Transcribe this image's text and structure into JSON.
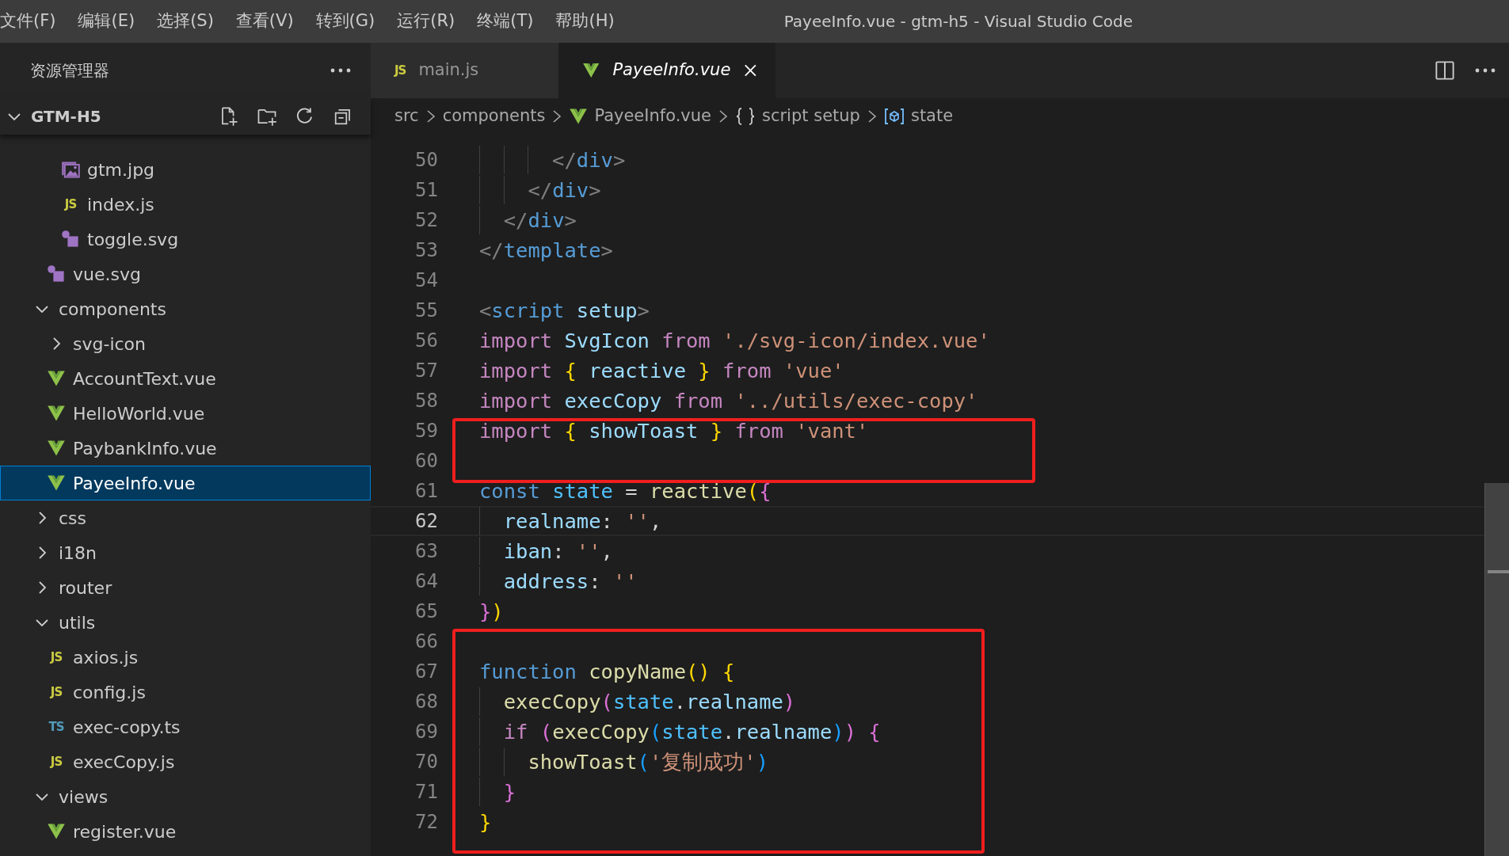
{
  "menu": [
    "文件(F)",
    "编辑(E)",
    "选择(S)",
    "查看(V)",
    "转到(G)",
    "运行(R)",
    "终端(T)",
    "帮助(H)"
  ],
  "window": {
    "title": "PayeeInfo.vue - gtm-h5 - Visual Studio Code"
  },
  "sidebar": {
    "title": "资源管理器",
    "tree": [
      {
        "label": "GTM-H5",
        "kind": "root",
        "expanded": true,
        "children": [
          {
            "kind": "offscreen",
            "children": [
              {
                "kind": "offscreen",
                "children": [
                  {
                    "kind": "offscreen",
                    "children": [
                      {
                        "label": "gtm.jpg",
                        "kind": "image",
                        "selected": false
                      },
                      {
                        "label": "index.js",
                        "kind": "js",
                        "badge": "JS",
                        "selected": false
                      },
                      {
                        "label": "toggle.svg",
                        "kind": "svg",
                        "selected": false
                      }
                    ]
                  },
                  {
                    "label": "vue.svg",
                    "kind": "svg",
                    "selected": false
                  }
                ]
              },
              {
                "label": "components",
                "kind": "folder",
                "expanded": true,
                "selected": false,
                "children": [
                  {
                    "label": "svg-icon",
                    "kind": "folder",
                    "expanded": false,
                    "selected": false
                  },
                  {
                    "label": "AccountText.vue",
                    "kind": "vue",
                    "selected": false
                  },
                  {
                    "label": "HelloWorld.vue",
                    "kind": "vue",
                    "selected": false
                  },
                  {
                    "label": "PaybankInfo.vue",
                    "kind": "vue",
                    "selected": false
                  },
                  {
                    "label": "PayeeInfo.vue",
                    "kind": "vue",
                    "selected": true
                  }
                ]
              },
              {
                "label": "css",
                "kind": "folder",
                "expanded": false,
                "selected": false
              },
              {
                "label": "i18n",
                "kind": "folder",
                "expanded": false,
                "selected": false
              },
              {
                "label": "router",
                "kind": "folder",
                "expanded": false,
                "selected": false
              },
              {
                "label": "utils",
                "kind": "folder",
                "expanded": true,
                "selected": false,
                "children": [
                  {
                    "label": "axios.js",
                    "kind": "js",
                    "badge": "JS",
                    "selected": false
                  },
                  {
                    "label": "config.js",
                    "kind": "js",
                    "badge": "JS",
                    "selected": false
                  },
                  {
                    "label": "exec-copy.ts",
                    "kind": "ts",
                    "badge": "TS",
                    "selected": false
                  },
                  {
                    "label": "execCopy.js",
                    "kind": "js",
                    "badge": "JS",
                    "selected": false
                  }
                ]
              },
              {
                "label": "views",
                "kind": "folder",
                "expanded": true,
                "selected": false,
                "children": [
                  {
                    "label": "register.vue",
                    "kind": "vue",
                    "selected": false
                  }
                ]
              }
            ]
          }
        ]
      }
    ]
  },
  "tabs": [
    {
      "label": "main.js",
      "kind": "js",
      "badge": "JS",
      "selected": false
    },
    {
      "label": "PayeeInfo.vue",
      "kind": "vue",
      "selected": true
    }
  ],
  "breadcrumb": [
    {
      "label": "src",
      "kind": "folder"
    },
    {
      "label": "components",
      "kind": "folder"
    },
    {
      "label": "PayeeInfo.vue",
      "kind": "vue"
    },
    {
      "label": "script setup",
      "kind": "module"
    },
    {
      "label": "state",
      "kind": "variable"
    }
  ],
  "code": {
    "sections": [
      {
        "boxed": false,
        "lines": [
          {
            "number": "50",
            "current": false,
            "tokens": [
              {
                "text": "      </",
                "kind": "punct"
              },
              {
                "text": "div",
                "kind": "tag"
              },
              {
                "text": ">",
                "kind": "punct"
              }
            ]
          },
          {
            "number": "51",
            "current": false,
            "tokens": [
              {
                "text": "    </",
                "kind": "punct"
              },
              {
                "text": "div",
                "kind": "tag"
              },
              {
                "text": ">",
                "kind": "punct"
              }
            ]
          },
          {
            "number": "52",
            "current": false,
            "tokens": [
              {
                "text": "  </",
                "kind": "punct"
              },
              {
                "text": "div",
                "kind": "tag"
              },
              {
                "text": ">",
                "kind": "punct"
              }
            ]
          },
          {
            "number": "53",
            "current": false,
            "tokens": [
              {
                "text": "</",
                "kind": "punct"
              },
              {
                "text": "template",
                "kind": "tag"
              },
              {
                "text": ">",
                "kind": "punct"
              }
            ]
          },
          {
            "number": "54",
            "current": false
          },
          {
            "number": "55",
            "current": false,
            "tokens": [
              {
                "text": "<",
                "kind": "punct"
              },
              {
                "text": "script ",
                "kind": "tag"
              },
              {
                "text": "setup",
                "kind": "var"
              },
              {
                "text": ">",
                "kind": "punct"
              }
            ]
          },
          {
            "number": "56",
            "current": false,
            "tokens": [
              {
                "text": "import ",
                "kind": "kw"
              },
              {
                "text": "SvgIcon ",
                "kind": "var"
              },
              {
                "text": "from ",
                "kind": "kw"
              },
              {
                "text": "'./svg-icon/index.vue'",
                "kind": "str"
              }
            ]
          },
          {
            "number": "57",
            "current": false,
            "tokens": [
              {
                "text": "import ",
                "kind": "kw"
              },
              {
                "text": "{ ",
                "kind": "b1"
              },
              {
                "text": "reactive ",
                "kind": "var"
              },
              {
                "text": "} ",
                "kind": "b1"
              },
              {
                "text": "from ",
                "kind": "kw"
              },
              {
                "text": "'vue'",
                "kind": "str"
              }
            ]
          },
          {
            "number": "58",
            "current": false,
            "tokens": [
              {
                "text": "import ",
                "kind": "kw"
              },
              {
                "text": "execCopy ",
                "kind": "var"
              },
              {
                "text": "from ",
                "kind": "kw"
              },
              {
                "text": "'../utils/exec-copy'",
                "kind": "str"
              }
            ]
          }
        ]
      },
      {
        "boxed": true,
        "lines": [
          {
            "number": "59",
            "current": false,
            "tokens": [
              {
                "text": "import ",
                "kind": "kw"
              },
              {
                "text": "{ ",
                "kind": "b1"
              },
              {
                "text": "showToast ",
                "kind": "var"
              },
              {
                "text": "} ",
                "kind": "b1"
              },
              {
                "text": "from ",
                "kind": "kw"
              },
              {
                "text": "'vant'",
                "kind": "str"
              }
            ]
          },
          {
            "number": "60",
            "current": false
          }
        ]
      },
      {
        "boxed": false,
        "lines": [
          {
            "number": "61",
            "current": false,
            "tokens": [
              {
                "text": "const ",
                "kind": "storage"
              },
              {
                "text": "state ",
                "kind": "const"
              },
              {
                "text": "= ",
                "kind": "plain"
              },
              {
                "text": "reactive",
                "kind": "fn"
              },
              {
                "text": "(",
                "kind": "b1"
              },
              {
                "text": "{",
                "kind": "b2"
              }
            ]
          },
          {
            "number": "62",
            "current": true,
            "tokens": [
              {
                "text": "  realname",
                "kind": "var"
              },
              {
                "text": ": ",
                "kind": "plain"
              },
              {
                "text": "''",
                "kind": "str"
              },
              {
                "text": ",",
                "kind": "plain"
              }
            ]
          },
          {
            "number": "63",
            "current": false,
            "tokens": [
              {
                "text": "  iban",
                "kind": "var"
              },
              {
                "text": ": ",
                "kind": "plain"
              },
              {
                "text": "''",
                "kind": "str"
              },
              {
                "text": ",",
                "kind": "plain"
              }
            ]
          },
          {
            "number": "64",
            "current": false,
            "tokens": [
              {
                "text": "  address",
                "kind": "var"
              },
              {
                "text": ": ",
                "kind": "plain"
              },
              {
                "text": "''",
                "kind": "str"
              }
            ]
          },
          {
            "number": "65",
            "current": false,
            "tokens": [
              {
                "text": "}",
                "kind": "b2"
              },
              {
                "text": ")",
                "kind": "b1"
              }
            ]
          }
        ]
      },
      {
        "boxed": true,
        "lines": [
          {
            "number": "66",
            "current": false
          },
          {
            "number": "67",
            "current": false,
            "tokens": [
              {
                "text": "function ",
                "kind": "storage"
              },
              {
                "text": "copyName",
                "kind": "fn"
              },
              {
                "text": "() ",
                "kind": "b1"
              },
              {
                "text": "{",
                "kind": "b1"
              }
            ]
          },
          {
            "number": "68",
            "current": false,
            "tokens": [
              {
                "text": "  execCopy",
                "kind": "fn"
              },
              {
                "text": "(",
                "kind": "b2"
              },
              {
                "text": "state",
                "kind": "const"
              },
              {
                "text": ".",
                "kind": "plain"
              },
              {
                "text": "realname",
                "kind": "var"
              },
              {
                "text": ")",
                "kind": "b2"
              }
            ]
          },
          {
            "number": "69",
            "current": false,
            "tokens": [
              {
                "text": "  if ",
                "kind": "kw"
              },
              {
                "text": "(",
                "kind": "b2"
              },
              {
                "text": "execCopy",
                "kind": "fn"
              },
              {
                "text": "(",
                "kind": "b3"
              },
              {
                "text": "state",
                "kind": "const"
              },
              {
                "text": ".",
                "kind": "plain"
              },
              {
                "text": "realname",
                "kind": "var"
              },
              {
                "text": ")",
                "kind": "b3"
              },
              {
                "text": ") {",
                "kind": "b2"
              }
            ]
          },
          {
            "number": "70",
            "current": false,
            "tokens": [
              {
                "text": "    showToast",
                "kind": "fn"
              },
              {
                "text": "(",
                "kind": "b3"
              },
              {
                "text": "'复制成功'",
                "kind": "str"
              },
              {
                "text": ")",
                "kind": "b3"
              }
            ]
          },
          {
            "number": "71",
            "current": false,
            "tokens": [
              {
                "text": "  }",
                "kind": "b2"
              }
            ]
          },
          {
            "number": "72",
            "current": false,
            "tokens": [
              {
                "text": "}",
                "kind": "b1"
              }
            ]
          }
        ]
      }
    ]
  }
}
